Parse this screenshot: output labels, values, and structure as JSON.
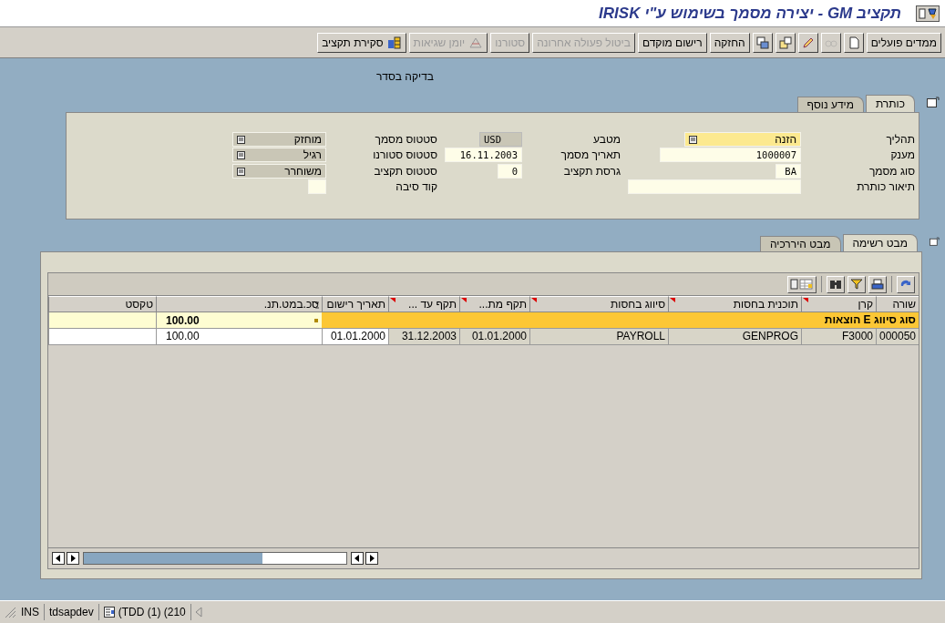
{
  "window": {
    "title": "תקציב GM - יצירה מסמך בשימוש ע\"י IRISK"
  },
  "toolbar": [
    {
      "kind": "text",
      "label": "ממדים פועלים",
      "disabled": false
    },
    {
      "kind": "icon",
      "disabled": false
    },
    {
      "kind": "icon",
      "disabled": true
    },
    {
      "kind": "icon",
      "disabled": false
    },
    {
      "kind": "icon",
      "disabled": false
    },
    {
      "kind": "icon",
      "disabled": false
    },
    {
      "kind": "text",
      "label": "החזקה",
      "disabled": false
    },
    {
      "kind": "text",
      "label": "רישום מוקדם",
      "disabled": false
    },
    {
      "kind": "text",
      "label": "ביטול פעולה אחרונה",
      "disabled": true
    },
    {
      "kind": "text",
      "label": "סטורנו",
      "disabled": true
    },
    {
      "kind": "icon-text",
      "label": "יומן שגיאות",
      "disabled": true
    },
    {
      "kind": "icon-text",
      "label": "סקירת תקציב",
      "disabled": false
    }
  ],
  "message": "בדיקה בסדר",
  "header": {
    "tabs": [
      {
        "label": "כותרת",
        "selected": true
      },
      {
        "label": "מידע נוסף",
        "selected": false
      }
    ],
    "groups": [
      [
        {
          "label": "תהליך",
          "value": "הזנה",
          "kind": "select",
          "focused": true
        },
        {
          "label": "מענק",
          "value": "1000007",
          "kind": "input",
          "focused": false
        },
        {
          "label": "סוג מסמך",
          "value": "BA",
          "kind": "input",
          "focused": false
        },
        {
          "label": "תיאור כותרת",
          "kind": "input",
          "focused": false
        }
      ],
      [
        {
          "label": "מטבע",
          "value": "USD",
          "kind": "display",
          "focused": false
        },
        {
          "label": "תאריך מסמך",
          "value": "16.11.2003",
          "kind": "input",
          "focused": false
        },
        {
          "label": "גרסת תקציב",
          "value": "0",
          "kind": "input",
          "focused": false
        }
      ],
      [
        {
          "label": "סטטוס מסמך",
          "value": "מוחזק",
          "kind": "select",
          "focused": false
        },
        {
          "label": "סטטוס סטורנו",
          "value": "רגיל",
          "kind": "select",
          "focused": false
        },
        {
          "label": "סטטוס תקציב",
          "value": "משוחרר",
          "kind": "select",
          "focused": false
        },
        {
          "label": "קוד סיבה",
          "kind": "input",
          "focused": false
        }
      ]
    ]
  },
  "items": {
    "tabs": [
      {
        "label": "מבט רשימה",
        "selected": true
      },
      {
        "label": "מבט היררכיה",
        "selected": false
      }
    ],
    "table": {
      "columns": [
        {
          "label": "שורה",
          "marked": false,
          "summed": false,
          "key": true
        },
        {
          "label": "קרן",
          "marked": true,
          "summed": false,
          "key": true
        },
        {
          "label": "תוכנית בחסות",
          "marked": true,
          "summed": false,
          "key": true
        },
        {
          "label": "סיווג בחסות",
          "marked": true,
          "summed": false,
          "key": true
        },
        {
          "label": "תקף מת...",
          "marked": true,
          "summed": false,
          "key": true
        },
        {
          "label": "תקף עד ...",
          "marked": true,
          "summed": false,
          "key": true
        },
        {
          "label": "תאריך רישום",
          "marked": false,
          "summed": false,
          "key": false
        },
        {
          "label": "סכ.במט.תנ.",
          "marked": false,
          "summed": true,
          "key": false
        },
        {
          "label": "טקסט",
          "marked": false,
          "summed": false,
          "key": false
        }
      ],
      "group": {
        "label": "סוג סיווג E הוצאות",
        "total": "100.00"
      },
      "rows": [
        [
          "000050",
          "F3000",
          "GENPROG",
          "PAYROLL",
          "01.01.2000",
          "31.12.2003",
          "01.01.2000",
          "100.00",
          ""
        ]
      ]
    }
  },
  "status": {
    "mode": "INS",
    "server": "tdsapdev",
    "session": "(TDD (1) (210"
  }
}
